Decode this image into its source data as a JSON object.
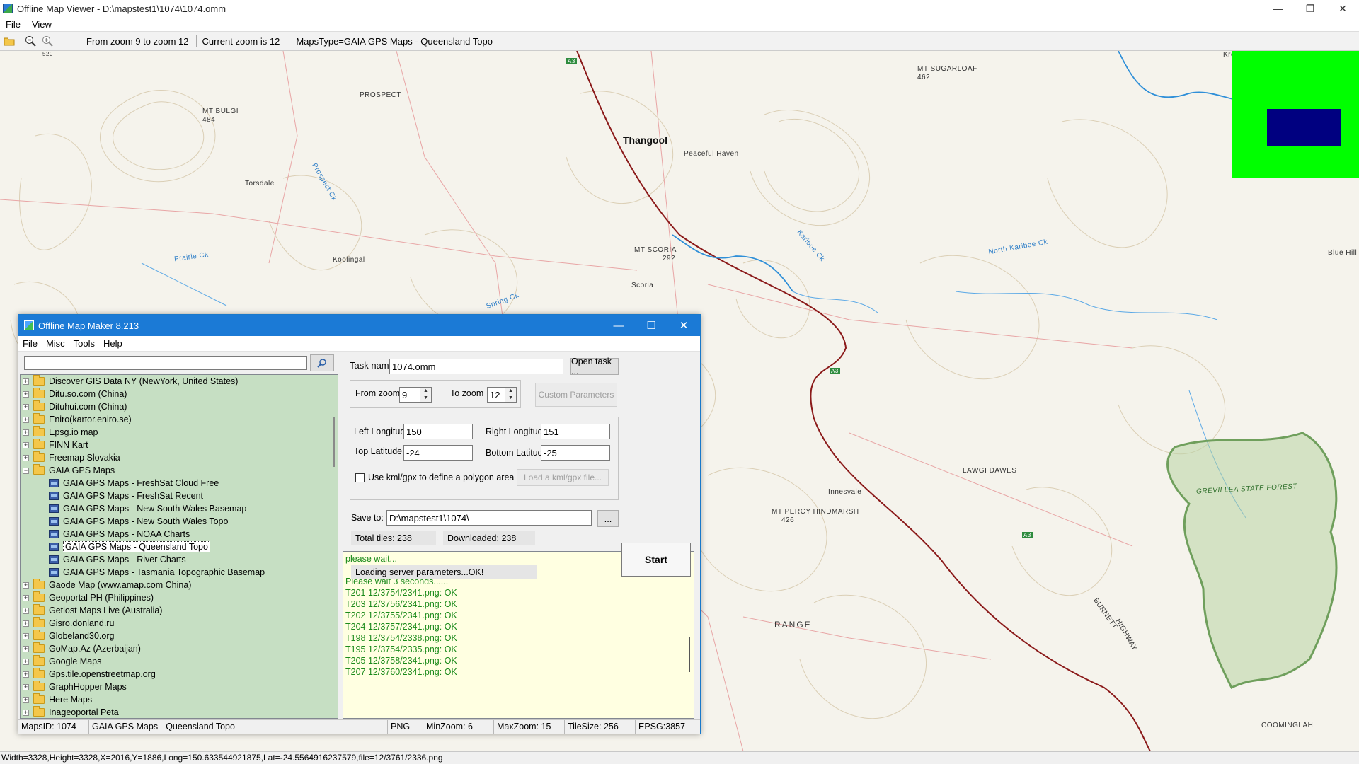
{
  "window": {
    "title": "Offline Map Viewer - D:\\mapstest1\\1074\\1074.omm",
    "controls": {
      "minimize": "—",
      "restore": "❐",
      "close": "✕"
    }
  },
  "menu": {
    "file": "File",
    "view": "View"
  },
  "toolbar": {
    "zoom_range": "From zoom 9 to zoom 12",
    "current_zoom": "Current zoom is 12",
    "maps_type": "MapsType=GAIA GPS Maps - Queensland Topo"
  },
  "map": {
    "labels": {
      "thangool": "Thangool",
      "prospect": "PROSPECT",
      "mt_bulgi": "MT BULGI",
      "mt_bulgi_h": "484",
      "torsdale": "Torsdale",
      "peaceful_haven": "Peaceful Haven",
      "mt_sugarloaf": "MT SUGARLOAF",
      "mt_sugarloaf_h": "462",
      "kroombit": "Kroombit",
      "mt_scoria": "MT SCORIA",
      "mt_scoria_h": "292",
      "scoria": "Scoria",
      "koolingal": "Koolingal",
      "prairie_ck": "Prairie Ck",
      "prospect_ck": "Prospect Ck",
      "spring_ck": "Spring Ck",
      "north_kariboe": "North Kariboe Ck",
      "kariboe_ck": "Kariboe Ck",
      "blue_hill": "Blue Hill",
      "lawgi_dawes": "LAWGI DAWES",
      "innesvale": "Innesvale",
      "mt_percy": "MT PERCY HINDMARSH",
      "mt_percy_h": "426",
      "grevillea": "GREVILLEA STATE FOREST",
      "range": "RANGE",
      "burnett": "BURNETT",
      "highway": "HIGHWAY",
      "coominglah": "COOMINGLAH",
      "a3_1": "A3",
      "a3_2": "A3",
      "a3_3": "A3",
      "h520": "520"
    },
    "colors": {
      "road": "#8b1a1a",
      "river": "#2f8fd8",
      "forest": "#7cb46a",
      "contour": "#c8b89a",
      "overview_bg": "#00ff00",
      "overview_vp": "#000080"
    }
  },
  "status": "Width=3328,Height=3328,X=2016,Y=1886,Long=150.633544921875,Lat=-24.5564916237579,file=12/3761/2336.png",
  "dialog": {
    "title": "Offline Map Maker 8.213",
    "controls": {
      "minimize": "—",
      "maximize": "☐",
      "close": "✕"
    },
    "menu": {
      "file": "File",
      "misc": "Misc",
      "tools": "Tools",
      "help": "Help"
    },
    "search": {
      "value": "",
      "placeholder": ""
    },
    "tree": [
      {
        "label": "Discover GIS Data NY (NewYork, United States)",
        "type": "folder"
      },
      {
        "label": "Ditu.so.com (China)",
        "type": "folder"
      },
      {
        "label": "Dituhui.com (China)",
        "type": "folder"
      },
      {
        "label": "Eniro(kartor.eniro.se)",
        "type": "folder"
      },
      {
        "label": "Epsg.io map",
        "type": "folder"
      },
      {
        "label": "FINN Kart",
        "type": "folder"
      },
      {
        "label": "Freemap Slovakia",
        "type": "folder"
      },
      {
        "label": "GAIA GPS Maps",
        "type": "folder-open"
      },
      {
        "label": "GAIA GPS Maps - FreshSat Cloud Free",
        "type": "child"
      },
      {
        "label": "GAIA GPS Maps - FreshSat Recent",
        "type": "child"
      },
      {
        "label": "GAIA GPS Maps - New South Wales Basemap",
        "type": "child"
      },
      {
        "label": "GAIA GPS Maps - New South Wales Topo",
        "type": "child"
      },
      {
        "label": "GAIA GPS Maps - NOAA Charts",
        "type": "child"
      },
      {
        "label": "GAIA GPS Maps - Queensland Topo",
        "type": "child-selected"
      },
      {
        "label": "GAIA GPS Maps - River Charts",
        "type": "child"
      },
      {
        "label": "GAIA GPS Maps - Tasmania Topographic Basemap",
        "type": "child"
      },
      {
        "label": "Gaode Map (www.amap.com China)",
        "type": "folder"
      },
      {
        "label": "Geoportal PH (Philippines)",
        "type": "folder"
      },
      {
        "label": "Getlost Maps Live (Australia)",
        "type": "folder"
      },
      {
        "label": "Gisro.donland.ru",
        "type": "folder"
      },
      {
        "label": "Globeland30.org",
        "type": "folder"
      },
      {
        "label": "GoMap.Az (Azerbaijan)",
        "type": "folder"
      },
      {
        "label": "Google Maps",
        "type": "folder"
      },
      {
        "label": "Gps.tile.openstreetmap.org",
        "type": "folder"
      },
      {
        "label": "GraphHopper Maps",
        "type": "folder"
      },
      {
        "label": "Here Maps",
        "type": "folder"
      },
      {
        "label": "Inageoportal Peta",
        "type": "folder"
      }
    ],
    "task_name_label": "Task name",
    "task_name": "1074.omm",
    "open_task": "Open task ...",
    "from_zoom_label": "From zoom",
    "from_zoom": "9",
    "to_zoom_label": "To zoom",
    "to_zoom": "12",
    "custom_params": "Custom Parameters",
    "left_lon_label": "Left Longitude",
    "left_lon": "150",
    "right_lon_label": "Right Longitude",
    "right_lon": "151",
    "top_lat_label": "Top Latitude",
    "top_lat": "-24",
    "bottom_lat_label": "Bottom Latitude",
    "bottom_lat": "-25",
    "use_kml_label": "Use kml/gpx to define a polygon area",
    "load_kml": "Load a kml/gpx file...",
    "save_to_label": "Save to:",
    "save_to": "D:\\mapstest1\\1074\\",
    "browse": "...",
    "total_tiles": "Total tiles: 238",
    "downloaded": "Downloaded: 238",
    "loading": "Loading server parameters...OK!",
    "start": "Start",
    "log": [
      "please wait...",
      "",
      "Please wait 3 seconds......",
      "T201 12/3754/2341.png: OK",
      "T203 12/3756/2341.png: OK",
      "T202 12/3755/2341.png: OK",
      "T204 12/3757/2341.png: OK",
      "T198 12/3754/2338.png: OK",
      "T195 12/3754/2335.png: OK",
      "T205 12/3758/2341.png: OK",
      "T207 12/3760/2341.png: OK"
    ],
    "status": {
      "maps_id": "MapsID: 1074",
      "maps_name": "GAIA GPS Maps - Queensland Topo",
      "format": "PNG",
      "min_zoom": "MinZoom: 6",
      "max_zoom": "MaxZoom: 15",
      "tile_size": "TileSize: 256",
      "epsg": "EPSG:3857"
    }
  }
}
